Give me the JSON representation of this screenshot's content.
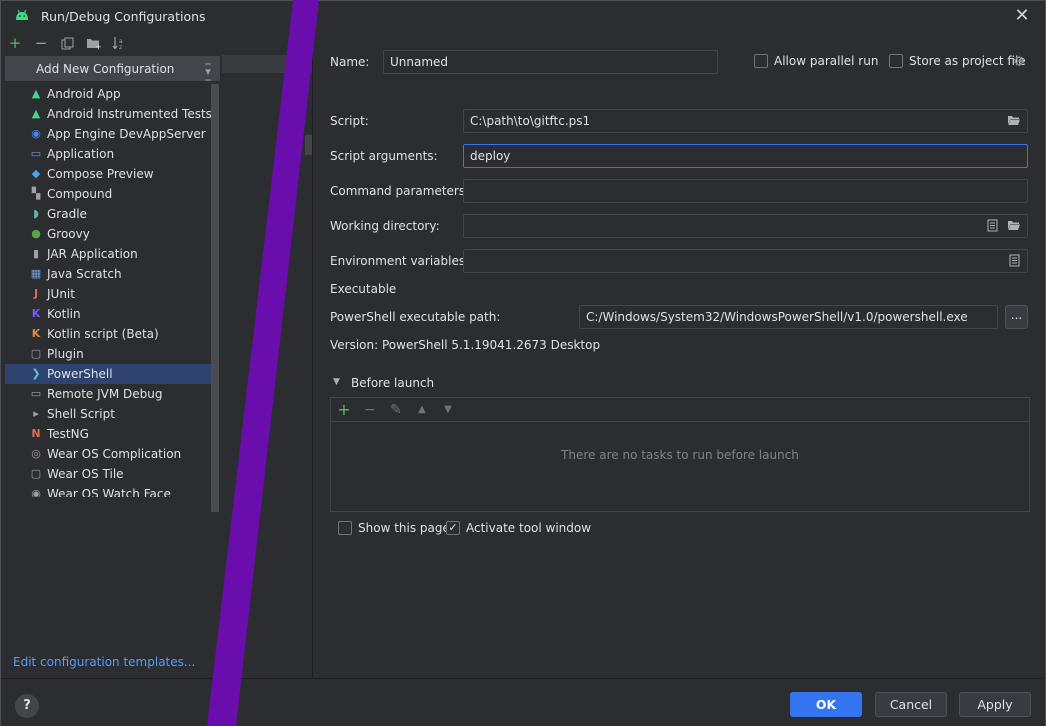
{
  "window": {
    "title": "Run/Debug Configurations"
  },
  "left": {
    "add_new_label": "Add New Configuration",
    "items": [
      {
        "label": "Android App",
        "icon": "android-icon",
        "color": "#3ddc84",
        "glyph": "▲"
      },
      {
        "label": "Android Instrumented Tests",
        "icon": "android-test-icon",
        "color": "#3ddc84",
        "glyph": "▲"
      },
      {
        "label": "App Engine DevAppServer",
        "icon": "app-engine-icon",
        "color": "#4285f4",
        "glyph": "◉"
      },
      {
        "label": "Application",
        "icon": "application-icon",
        "color": "#6e9bd8",
        "glyph": "▭"
      },
      {
        "label": "Compose Preview",
        "icon": "compose-icon",
        "color": "#42a5f5",
        "glyph": "◆"
      },
      {
        "label": "Compound",
        "icon": "compound-icon",
        "color": "#9da0a8",
        "glyph": "▚"
      },
      {
        "label": "Gradle",
        "icon": "gradle-icon",
        "color": "#5fb3a6",
        "glyph": "◗"
      },
      {
        "label": "Groovy",
        "icon": "groovy-icon",
        "color": "#57a64a",
        "glyph": "●"
      },
      {
        "label": "JAR Application",
        "icon": "jar-icon",
        "color": "#9da0a8",
        "glyph": "▮"
      },
      {
        "label": "Java Scratch",
        "icon": "java-scratch-icon",
        "color": "#6e9bd8",
        "glyph": "▦"
      },
      {
        "label": "JUnit",
        "icon": "junit-icon",
        "color": "#e06c4b",
        "glyph": "J"
      },
      {
        "label": "Kotlin",
        "icon": "kotlin-icon",
        "color": "#7f52ff",
        "glyph": "K"
      },
      {
        "label": "Kotlin script (Beta)",
        "icon": "kotlin-script-icon",
        "color": "#e3883d",
        "glyph": "K"
      },
      {
        "label": "Plugin",
        "icon": "plugin-icon",
        "color": "#9da0a8",
        "glyph": "▢"
      },
      {
        "label": "PowerShell",
        "icon": "powershell-icon",
        "color": "#5bc0de",
        "glyph": "❯"
      },
      {
        "label": "Remote JVM Debug",
        "icon": "remote-debug-icon",
        "color": "#9da0a8",
        "glyph": "▭"
      },
      {
        "label": "Shell Script",
        "icon": "shell-icon",
        "color": "#9da0a8",
        "glyph": "▸"
      },
      {
        "label": "TestNG",
        "icon": "testng-icon",
        "color": "#e06c4b",
        "glyph": "N"
      },
      {
        "label": "Wear OS Complication",
        "icon": "wear-complication-icon",
        "color": "#9da0a8",
        "glyph": "◎"
      },
      {
        "label": "Wear OS Tile",
        "icon": "wear-tile-icon",
        "color": "#9da0a8",
        "glyph": "▢"
      },
      {
        "label": "Wear OS Watch Face",
        "icon": "wear-watchface-icon",
        "color": "#9da0a8",
        "glyph": "◉"
      }
    ],
    "selected_index": 14,
    "edit_templates": "Edit configuration templates..."
  },
  "form": {
    "name_label": "Name:",
    "name_value": "Unnamed",
    "allow_parallel": "Allow parallel run",
    "store_project": "Store as project file",
    "script_label": "Script:",
    "script_value": "C:\\path\\to\\gitftc.ps1",
    "args_label": "Script arguments:",
    "args_value": "deploy",
    "cmd_label": "Command parameters",
    "cmd_value": "",
    "workdir_label": "Working directory:",
    "workdir_value": "",
    "env_label": "Environment variables:",
    "env_value": "",
    "executable_header": "Executable",
    "ps_path_label": "PowerShell executable path:",
    "ps_path_value": "C:/Windows/System32/WindowsPowerShell/v1.0/powershell.exe",
    "browse_dots": "...",
    "version_text": "Version: PowerShell 5.1.19041.2673 Desktop",
    "before_launch": "Before launch",
    "no_tasks": "There are no tasks to run before launch",
    "show_page": "Show this page",
    "activate_tool": "Activate tool window"
  },
  "buttons": {
    "ok": "OK",
    "cancel": "Cancel",
    "apply": "Apply",
    "help": "?"
  },
  "colors": {
    "accent": "#3574f0",
    "stripe": "#6a0dad",
    "link": "#589df6"
  }
}
